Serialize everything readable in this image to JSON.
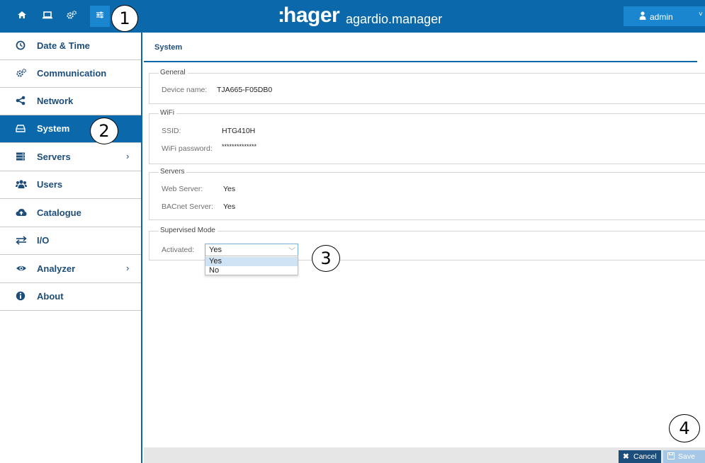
{
  "header": {
    "nav_icons": [
      "home-icon",
      "monitor-icon",
      "gears-icon",
      "sliders-icon"
    ],
    "brand": "hager",
    "brand_sub": "agardio.manager",
    "user": "admin"
  },
  "sidebar": {
    "items": [
      {
        "label": "Date & Time",
        "icon": "clock-icon"
      },
      {
        "label": "Communication",
        "icon": "gears-icon"
      },
      {
        "label": "Network",
        "icon": "share-icon"
      },
      {
        "label": "System",
        "icon": "drive-icon"
      },
      {
        "label": "Servers",
        "icon": "server-icon"
      },
      {
        "label": "Users",
        "icon": "users-icon"
      },
      {
        "label": "Catalogue",
        "icon": "cloud-upload-icon"
      },
      {
        "label": "I/O",
        "icon": "exchange-icon"
      },
      {
        "label": "Analyzer",
        "icon": "eye-icon"
      },
      {
        "label": "About",
        "icon": "info-icon"
      }
    ],
    "active": "System"
  },
  "main": {
    "title": "System",
    "general": {
      "legend": "General",
      "device_name_label": "Device name:",
      "device_name_value": "TJA665-F05DB0"
    },
    "wifi": {
      "legend": "WiFi",
      "ssid_label": "SSID:",
      "ssid_value": "HTG410H",
      "password_label": "WiFi password:",
      "password_value": "**************"
    },
    "servers": {
      "legend": "Servers",
      "web_label": "Web Server:",
      "web_value": "Yes",
      "bacnet_label": "BACnet Server:",
      "bacnet_value": "Yes"
    },
    "supervised": {
      "legend": "Supervised Mode",
      "activated_label": "Activated:",
      "selected": "Yes",
      "options": [
        "Yes",
        "No"
      ]
    }
  },
  "footer": {
    "cancel": "Cancel",
    "save": "Save"
  },
  "callouts": [
    "1",
    "2",
    "3",
    "4"
  ]
}
